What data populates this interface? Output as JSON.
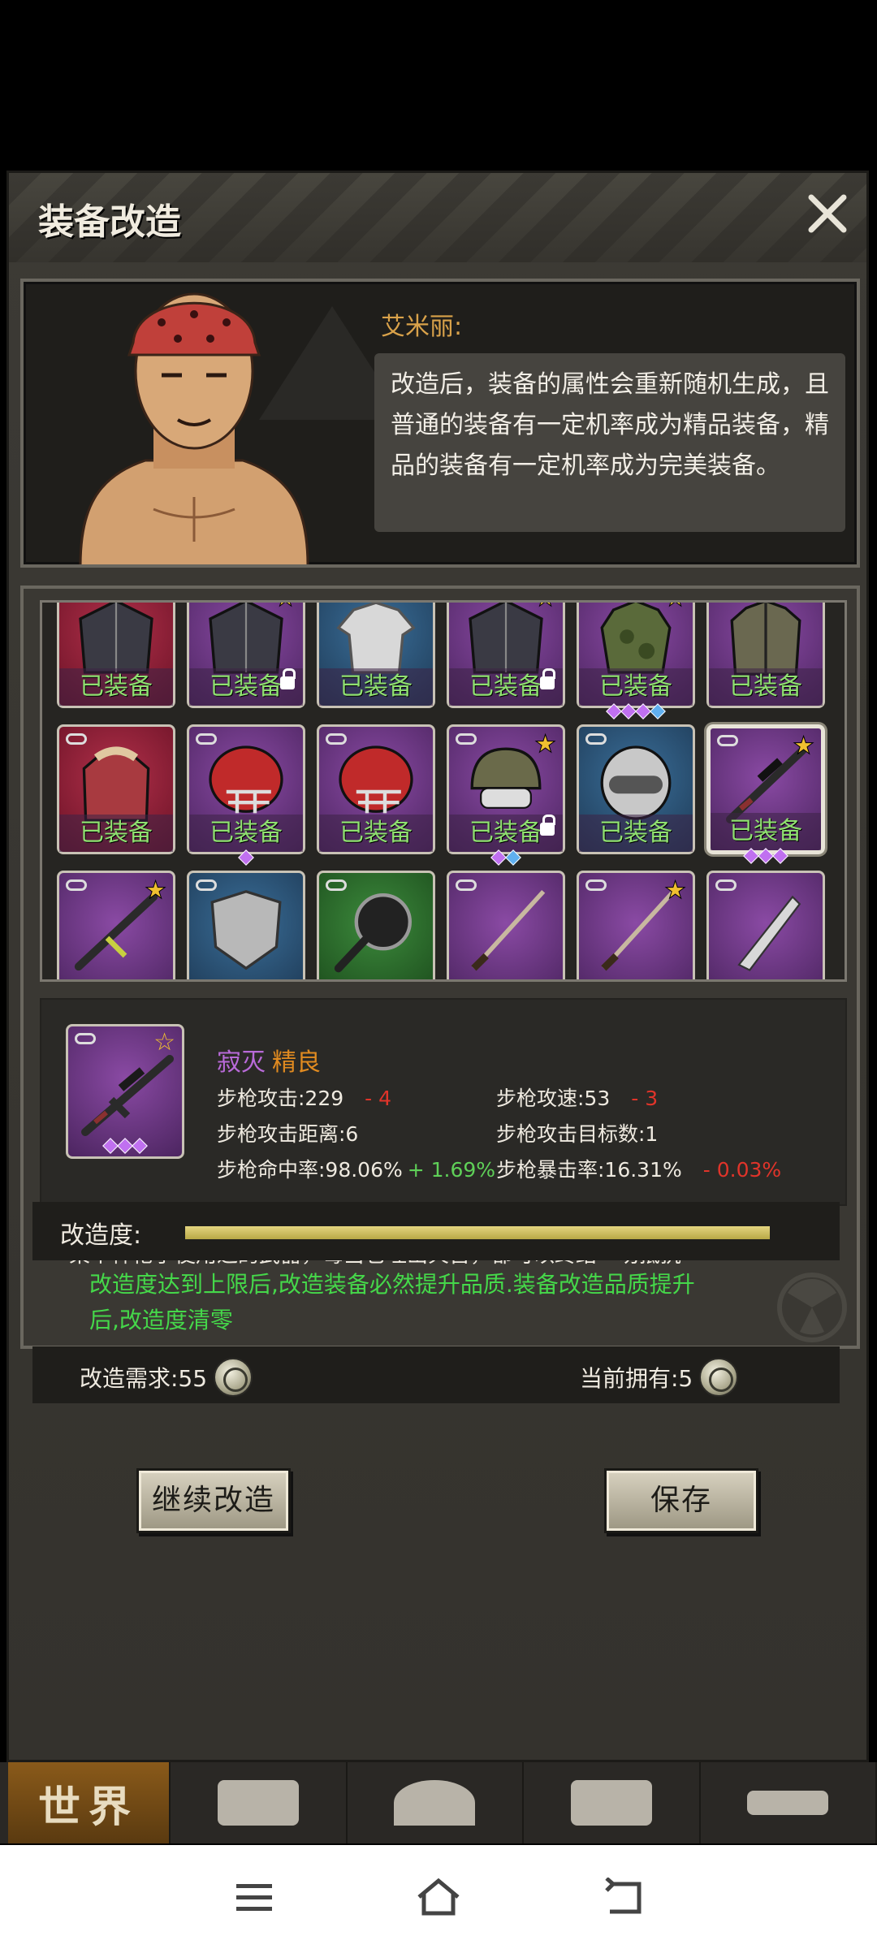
{
  "dialog": {
    "title": "装备改造",
    "close_icon": "close-icon"
  },
  "npc": {
    "name": "艾米丽:",
    "speech": "改造后，装备的属性会重新随机生成，且普通的装备有一定机率成为精品装备，精品的装备有一定机率成为完美装备。"
  },
  "grid": {
    "equipped_label": "已装备",
    "rows": [
      [
        {
          "rarity": "red",
          "icon": "jacket-icon",
          "equipped": true,
          "star": false,
          "lock": false,
          "gems": []
        },
        {
          "rarity": "purple",
          "icon": "jacket-icon",
          "equipped": true,
          "star": true,
          "lock": true,
          "gems": []
        },
        {
          "rarity": "blue",
          "icon": "shirt-icon",
          "equipped": true,
          "star": false,
          "lock": false,
          "gems": []
        },
        {
          "rarity": "purple",
          "icon": "jacket-icon",
          "equipped": true,
          "star": true,
          "lock": true,
          "gems": []
        },
        {
          "rarity": "purple",
          "icon": "camo-armor-icon",
          "equipped": true,
          "star": true,
          "lock": false,
          "gems": [
            "#c070f0",
            "#c070f0",
            "#c070f0",
            "#60b0f0"
          ]
        },
        {
          "rarity": "purple",
          "icon": "coat-icon",
          "equipped": true,
          "star": false,
          "lock": false,
          "gems": []
        }
      ],
      [
        {
          "rarity": "red",
          "icon": "fur-coat-icon",
          "equipped": true,
          "star": false,
          "lock": false,
          "gems": []
        },
        {
          "rarity": "purple",
          "icon": "football-helmet-icon",
          "equipped": true,
          "star": false,
          "lock": false,
          "gems": [
            "#c070f0"
          ]
        },
        {
          "rarity": "purple",
          "icon": "football-helmet-icon",
          "equipped": true,
          "star": false,
          "lock": false,
          "gems": []
        },
        {
          "rarity": "purple",
          "icon": "military-helmet-icon",
          "equipped": true,
          "star": true,
          "lock": true,
          "gems": [
            "#c070f0",
            "#60b0f0"
          ]
        },
        {
          "rarity": "blue",
          "icon": "motorcycle-helmet-icon",
          "equipped": true,
          "star": false,
          "lock": false,
          "gems": []
        },
        {
          "rarity": "purple",
          "icon": "sniper-rifle-icon",
          "equipped": true,
          "star": true,
          "lock": false,
          "selected": true,
          "gems": [
            "#c070f0",
            "#c070f0",
            "#c070f0"
          ]
        }
      ],
      [
        {
          "rarity": "purple",
          "icon": "assault-rifle-icon",
          "equipped": false,
          "star": true,
          "lock": false,
          "gems": []
        },
        {
          "rarity": "blue",
          "icon": "riot-shield-icon",
          "equipped": false,
          "star": false,
          "lock": false,
          "gems": []
        },
        {
          "rarity": "green",
          "icon": "frying-pan-icon",
          "equipped": false,
          "star": false,
          "lock": false,
          "gems": []
        },
        {
          "rarity": "purple",
          "icon": "katana-icon",
          "equipped": false,
          "star": false,
          "lock": false,
          "gems": []
        },
        {
          "rarity": "purple",
          "icon": "katana-icon",
          "equipped": false,
          "star": true,
          "lock": false,
          "gems": []
        },
        {
          "rarity": "purple",
          "icon": "machete-icon",
          "equipped": false,
          "star": false,
          "lock": false,
          "gems": []
        }
      ]
    ]
  },
  "detail": {
    "name": "寂灭",
    "quality": "精良",
    "stats": [
      {
        "label": "步枪攻击:229",
        "delta": "- 4",
        "tone": "neg"
      },
      {
        "label": "步枪攻速:53",
        "delta": "- 3",
        "tone": "neg"
      },
      {
        "label": "步枪攻击距离:6",
        "delta": "",
        "tone": ""
      },
      {
        "label": "步枪攻击目标数:1",
        "delta": "",
        "tone": ""
      },
      {
        "label": "步枪命中率:98.06%",
        "delta": "+ 1.69%",
        "tone": "pos"
      },
      {
        "label": "步枪暴击率:16.31%",
        "delta": "- 0.03%",
        "tone": "neg"
      }
    ],
    "description": "某个神枪手使用过的武器，每当它吐出火舌，都可以终结一切抵抗",
    "gems": [
      "#c070f0",
      "#c070f0",
      "#c070f0"
    ]
  },
  "reform": {
    "label": "改造度:",
    "progress": 1.0,
    "note": "改造度达到上限后,改造装备必然提升品质.装备改造品质提升后,改造度清零",
    "requirement": "改造需求:55",
    "owned": "当前拥有:5"
  },
  "buttons": {
    "continue": "继续改造",
    "save": "保存"
  },
  "bottom_nav": {
    "world": "世界"
  }
}
